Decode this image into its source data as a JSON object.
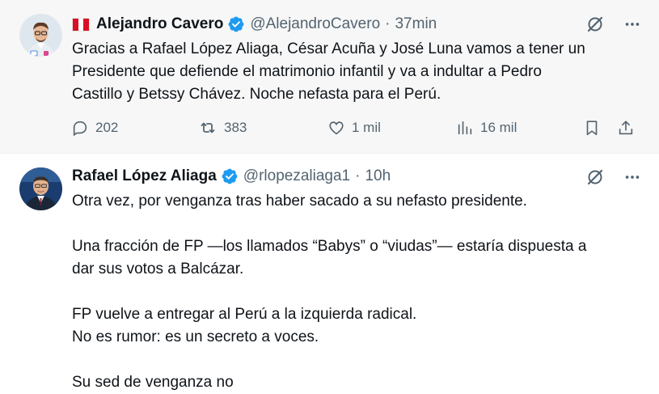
{
  "tweets": [
    {
      "author_name": "Alejandro Cavero",
      "handle": "@AlejandroCavero",
      "separator": "·",
      "time": "37min",
      "lines": [
        "Gracias a Rafael López Aliaga, César Acuña y José Luna vamos a tener un",
        "Presidente que defiende el matrimonio infantil y va a indultar a Pedro",
        "Castillo y Betssy Chávez. Noche nefasta para el Perú."
      ],
      "flag_colors": [
        "#d91023",
        "#ffffff",
        "#d91023"
      ],
      "stats": {
        "replies": "202",
        "reposts": "383",
        "likes": "1 mil",
        "views": "16 mil"
      }
    },
    {
      "author_name": "Rafael López Aliaga",
      "handle": "@rlopezaliaga1",
      "separator": "·",
      "time": "10h",
      "lines": [
        "Otra vez, por venganza tras haber sacado a su nefasto presidente.",
        "",
        "Una fracción de FP —los llamados “Babys” o “viudas”— estaría dispuesta a",
        "dar sus votos a Balcázar.",
        "",
        "FP vuelve a entregar al Perú a la izquierda radical.",
        "No es rumor: es un secreto a voces.",
        "",
        "Su sed de venganza no"
      ]
    }
  ],
  "icons": {
    "grok": "grok-slash-icon",
    "more": "more-dots-icon",
    "reply": "reply-bubble-icon",
    "repost": "repost-arrows-icon",
    "like": "heart-icon",
    "views": "views-bars-icon",
    "bookmark": "bookmark-icon",
    "share": "share-upload-icon",
    "verified": "verified-badge-icon"
  },
  "colors": {
    "verified": "#1d9bf0",
    "muted": "#536471",
    "text": "#0f1419",
    "hover_bg": "#f7f7f7"
  }
}
